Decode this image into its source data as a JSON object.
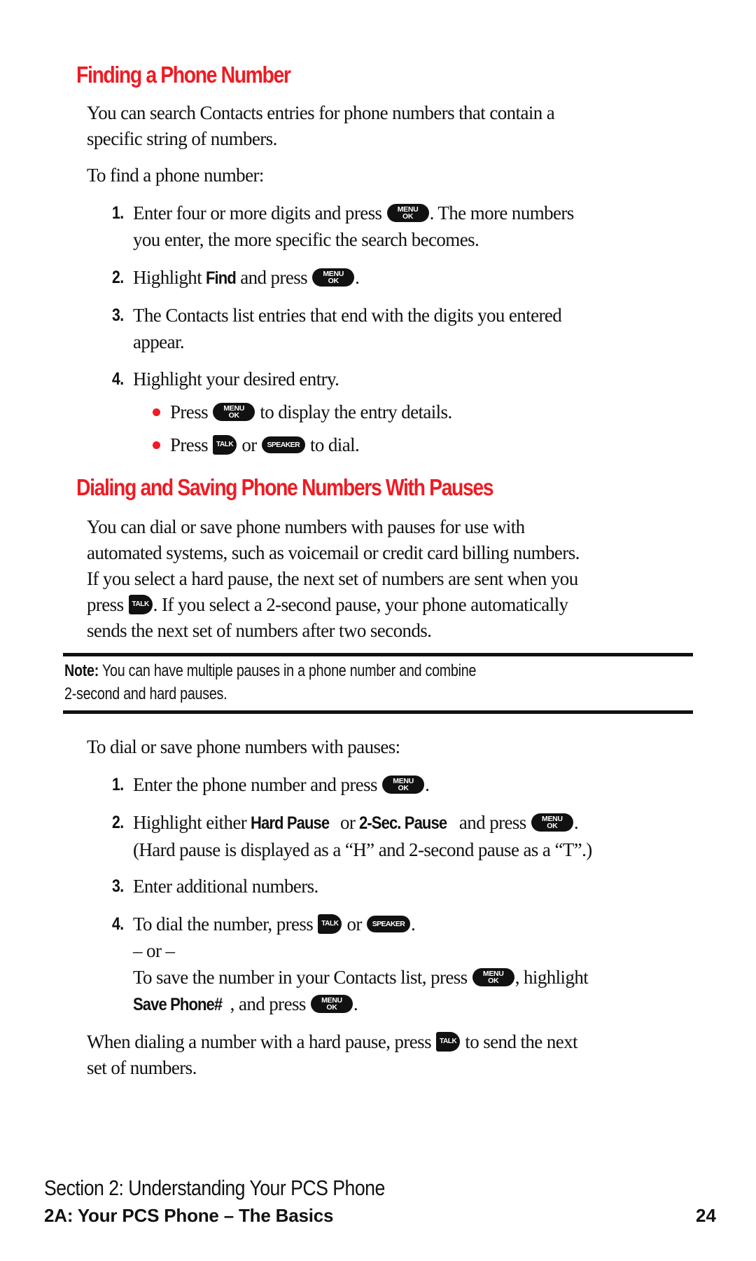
{
  "section1": {
    "title": "Finding a Phone Number",
    "intro_line1": "You can search Contacts entries for phone numbers that contain a",
    "intro_line2": "specific string of numbers.",
    "lead": "To find a phone number:",
    "steps": [
      {
        "num": "1.",
        "line1_a": "Enter four or more digits and press",
        "key1": "menu-ok",
        "line1_b": ". The more numbers",
        "line2": "you enter, the more specific the search becomes."
      },
      {
        "num": "2.",
        "a": "Highlight",
        "bold": "Find",
        "b": "and press",
        "key": "menu-ok",
        "c": "."
      },
      {
        "num": "3.",
        "line1": "The Contacts list entries that end with the digits you entered",
        "line2": "appear."
      },
      {
        "num": "4.",
        "line1": "Highlight your desired entry."
      }
    ],
    "bullets": [
      {
        "a": "Press",
        "key": "menu-ok",
        "b": "to display the entry details."
      },
      {
        "a": "Press",
        "key1": "talk",
        "or": "or",
        "key2": "speaker",
        "b": "to dial."
      }
    ]
  },
  "section2": {
    "title": "Dialing and Saving Phone Numbers With Pauses",
    "para": [
      "You can dial or save phone numbers with pauses for use with",
      "automated systems, such as voicemail or credit card billing numbers.",
      "If you select a hard pause, the next set of numbers are sent when you"
    ],
    "para_line4_a": "press",
    "para_line4_b": ". If you select a 2-second pause, your phone automatically",
    "para_line5": "sends the next set of numbers after two seconds.",
    "note_label": "Note:",
    "note_line1": " You can have multiple pauses in a phone number and combine",
    "note_line2": "2-second and hard pauses.",
    "lead": "To dial or save phone numbers with pauses:",
    "steps": [
      {
        "num": "1.",
        "a": "Enter the phone number and press",
        "key": "menu-ok",
        "b": "."
      },
      {
        "num": "2.",
        "a": "Highlight either",
        "bold1": "Hard Pause",
        "or": "or",
        "bold2": "2-Sec. Pause",
        "b": "and press",
        "key": "menu-ok",
        "c": ".",
        "line2": "(Hard pause is displayed as a “H” and 2-second pause as a “T”.)"
      },
      {
        "num": "3.",
        "a": "Enter additional numbers."
      },
      {
        "num": "4.",
        "a": "To dial the number, press",
        "key1": "talk",
        "or": "or",
        "key2": "speaker",
        "b": ".",
        "alt": "– or –",
        "save_a": "To save the number in your Contacts list, press",
        "save_key": "menu-ok",
        "save_b": ", highlight",
        "save_bold": "Save Phone#",
        "save_c": ", and press",
        "save_key2": "menu-ok",
        "save_d": "."
      }
    ],
    "closing_a": "When dialing a number with a hard pause, press",
    "closing_key": "talk",
    "closing_b": "to send the next",
    "closing_line2": "set of numbers."
  },
  "keys": {
    "menu_top": "MENU",
    "menu_bottom": "OK",
    "talk": "TALK",
    "speaker": "SPEAKER"
  },
  "footer": {
    "section": "Section 2: Understanding Your PCS Phone",
    "chapter": "2A: Your PCS Phone – The Basics",
    "page": "24"
  },
  "colors": {
    "heading": "#ee1c24",
    "bullet": "#ee1c24",
    "text": "#111111"
  }
}
